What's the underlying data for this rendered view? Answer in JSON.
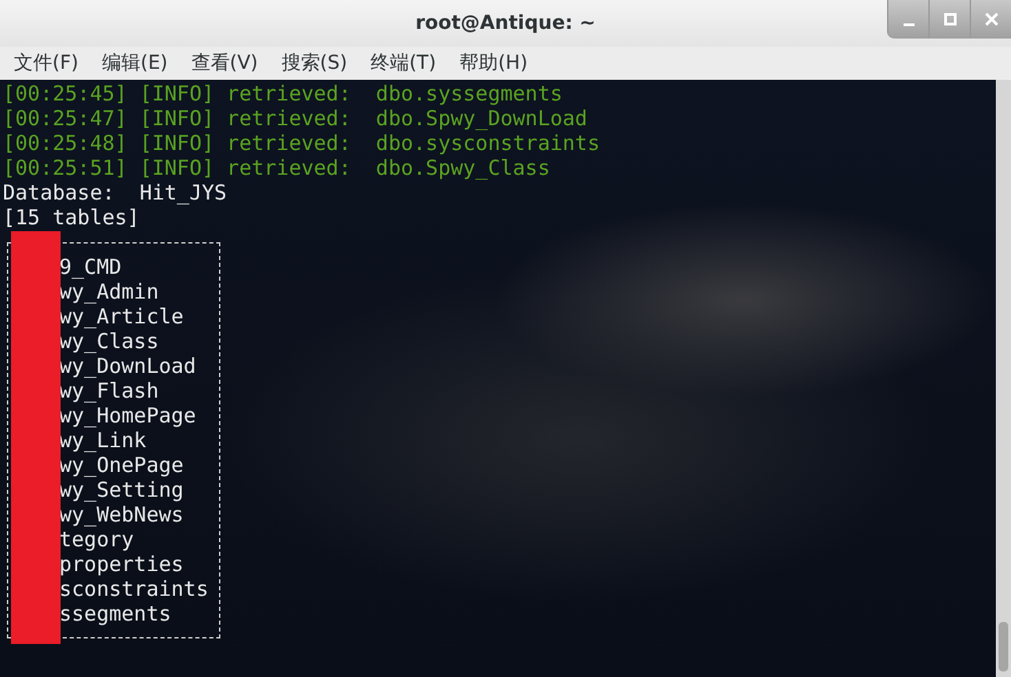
{
  "window": {
    "title": "root@Antique: ~"
  },
  "menu": [
    "文件(F)",
    "编辑(E)",
    "查看(V)",
    "搜索(S)",
    "终端(T)",
    "帮助(H)"
  ],
  "log_lines": [
    {
      "time": "[00:25:45]",
      "level": "[INFO]",
      "message": "retrieved:  dbo.syssegments"
    },
    {
      "time": "[00:25:47]",
      "level": "[INFO]",
      "message": "retrieved:  dbo.Spwy_DownLoad"
    },
    {
      "time": "[00:25:48]",
      "level": "[INFO]",
      "message": "retrieved:  dbo.sysconstraints"
    },
    {
      "time": "[00:25:51]",
      "level": "[INFO]",
      "message": "retrieved:  dbo.Spwy_Class"
    }
  ],
  "database_line": "Database:  Hit_JYS",
  "table_count": "[15 tables]",
  "tables": [
    "9_CMD",
    "wy_Admin",
    "wy_Article",
    "wy_Class",
    "wy_DownLoad",
    "wy_Flash",
    "wy_HomePage",
    "wy_Link",
    "wy_OnePage",
    "wy_Setting",
    "wy_WebNews",
    "tegory",
    "properties",
    "sconstraints",
    "ssegments"
  ]
}
